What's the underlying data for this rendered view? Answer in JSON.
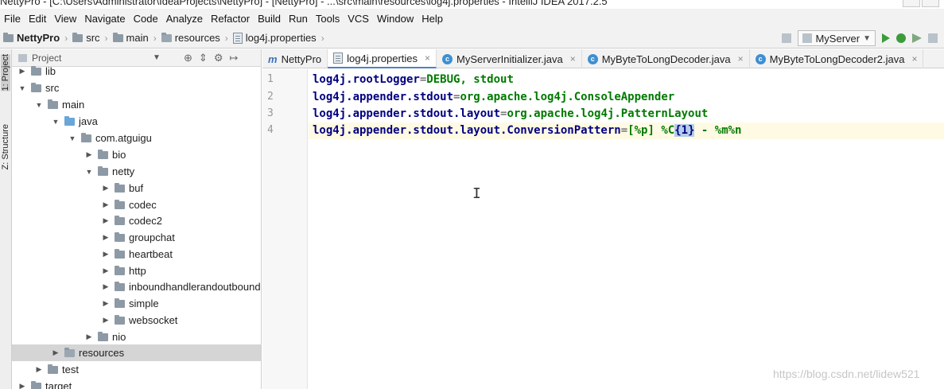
{
  "window": {
    "title": "NettyPro - [C:\\Users\\Administrator\\IdeaProjects\\NettyPro] - [NettyPro] - ...\\src\\main\\resources\\log4j.properties - IntelliJ IDEA 2017.2.5"
  },
  "menu": [
    "File",
    "Edit",
    "View",
    "Navigate",
    "Code",
    "Analyze",
    "Refactor",
    "Build",
    "Run",
    "Tools",
    "VCS",
    "Window",
    "Help"
  ],
  "breadcrumb": [
    "NettyPro",
    "src",
    "main",
    "resources",
    "log4j.properties"
  ],
  "run_config": "MyServer",
  "side_tabs": [
    "1: Project",
    "Z: Structure"
  ],
  "project_panel": {
    "title": "Project",
    "tree": [
      {
        "label": "lib",
        "indent": 0,
        "expanded": false,
        "icon": "folder-icon"
      },
      {
        "label": "src",
        "indent": 0,
        "expanded": true,
        "icon": "folder-icon"
      },
      {
        "label": "main",
        "indent": 1,
        "expanded": true,
        "icon": "folder-icon"
      },
      {
        "label": "java",
        "indent": 2,
        "expanded": true,
        "icon": "source-folder-icon"
      },
      {
        "label": "com.atguigu",
        "indent": 3,
        "expanded": true,
        "icon": "package-icon"
      },
      {
        "label": "bio",
        "indent": 4,
        "expanded": false,
        "icon": "package-icon"
      },
      {
        "label": "netty",
        "indent": 4,
        "expanded": true,
        "icon": "package-icon"
      },
      {
        "label": "buf",
        "indent": 5,
        "expanded": false,
        "icon": "package-icon"
      },
      {
        "label": "codec",
        "indent": 5,
        "expanded": false,
        "icon": "package-icon"
      },
      {
        "label": "codec2",
        "indent": 5,
        "expanded": false,
        "icon": "package-icon"
      },
      {
        "label": "groupchat",
        "indent": 5,
        "expanded": false,
        "icon": "package-icon"
      },
      {
        "label": "heartbeat",
        "indent": 5,
        "expanded": false,
        "icon": "package-icon"
      },
      {
        "label": "http",
        "indent": 5,
        "expanded": false,
        "icon": "package-icon"
      },
      {
        "label": "inboundhandlerandoutbound",
        "indent": 5,
        "expanded": false,
        "icon": "package-icon"
      },
      {
        "label": "simple",
        "indent": 5,
        "expanded": false,
        "icon": "package-icon"
      },
      {
        "label": "websocket",
        "indent": 5,
        "expanded": false,
        "icon": "package-icon"
      },
      {
        "label": "nio",
        "indent": 4,
        "expanded": false,
        "icon": "package-icon"
      },
      {
        "label": "resources",
        "indent": 2,
        "expanded": false,
        "icon": "resources-folder-icon",
        "selected": true
      },
      {
        "label": "test",
        "indent": 1,
        "expanded": false,
        "icon": "folder-icon"
      },
      {
        "label": "target",
        "indent": 0,
        "expanded": false,
        "icon": "folder-icon"
      }
    ]
  },
  "tabs": [
    {
      "label": "NettyPro",
      "icon": "module-icon",
      "active": false
    },
    {
      "label": "log4j.properties",
      "icon": "properties-file-icon",
      "active": true
    },
    {
      "label": "MyServerInitializer.java",
      "icon": "class-icon",
      "active": false
    },
    {
      "label": "MyByteToLongDecoder.java",
      "icon": "class-icon",
      "active": false
    },
    {
      "label": "MyByteToLongDecoder2.java",
      "icon": "class-icon",
      "active": false
    }
  ],
  "editor": {
    "line_numbers": [
      "1",
      "2",
      "3",
      "4"
    ],
    "lines": [
      {
        "key": "log4j.rootLogger",
        "value": "DEBUG, stdout"
      },
      {
        "key": "log4j.appender.stdout",
        "value": "org.apache.log4j.ConsoleAppender"
      },
      {
        "key": "log4j.appender.stdout.layout",
        "value": "org.apache.log4j.PatternLayout"
      },
      {
        "key": "log4j.appender.stdout.layout.ConversionPattern",
        "value_parts": [
          "[%p] %C",
          "{1}",
          " - %m%n"
        ]
      }
    ]
  },
  "watermark": "https://blog.csdn.net/lidew521"
}
